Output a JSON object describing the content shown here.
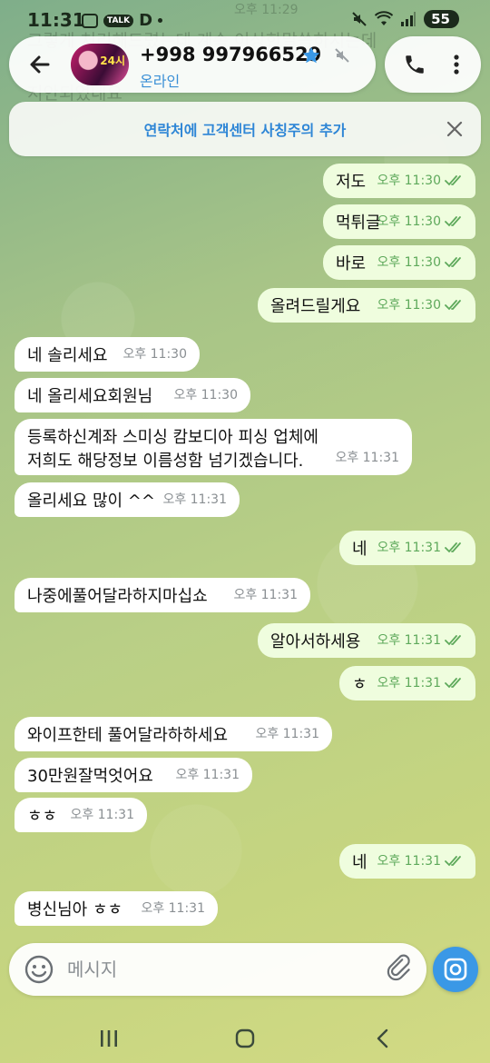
{
  "status_bar": {
    "time": "11:31",
    "talk_badge": "TALK",
    "d_badge": "D",
    "battery": "55"
  },
  "ghost_lines": [
    "그렇게 처리해드렸는데 계속 이상한말씀하시는데",
    "지안되었네요"
  ],
  "ghost_time": "오후 11:29",
  "header": {
    "contact_name": "+998 997966529",
    "status": "온라인",
    "avatar_label": "24시"
  },
  "banner": {
    "text": "연락처에 고객센터 사칭주의 추가"
  },
  "messages": [
    {
      "dir": "out",
      "text": "저도",
      "time": "오후 11:30"
    },
    {
      "dir": "out",
      "text": "먹튀글",
      "time": "오후 11:30"
    },
    {
      "dir": "out",
      "text": "바로",
      "time": "오후 11:30"
    },
    {
      "dir": "out",
      "text": "올려드릴게요",
      "time": "오후 11:30"
    },
    {
      "dir": "in",
      "text": "네 솔리세요",
      "time": "오후 11:30"
    },
    {
      "dir": "in",
      "text": "네 올리세요회원님",
      "time": "오후 11:30"
    },
    {
      "dir": "in",
      "text": "등록하신계좌 스미싱 캄보디아 피싱 업체에",
      "text2": "저희도 해당정보 이름성함 넘기겠습니다.",
      "time": "오후 11:31"
    },
    {
      "dir": "in",
      "text": "올리세요 많이 ^^",
      "time": "오후 11:31"
    },
    {
      "dir": "out",
      "text": "네",
      "time": "오후 11:31"
    },
    {
      "dir": "in",
      "text": "나중에풀어달라하지마십쇼",
      "time": "오후 11:31"
    },
    {
      "dir": "out",
      "text": "알아서하세용",
      "time": "오후 11:31"
    },
    {
      "dir": "out",
      "text": "ㅎ",
      "time": "오후 11:31"
    },
    {
      "dir": "in",
      "text": "와이프한테 풀어달라하하세요",
      "time": "오후 11:31"
    },
    {
      "dir": "in",
      "text": "30만원잘먹엇어요",
      "time": "오후 11:31"
    },
    {
      "dir": "in",
      "text": "ㅎㅎ",
      "time": "오후 11:31"
    },
    {
      "dir": "out",
      "text": "네",
      "time": "오후 11:31"
    },
    {
      "dir": "in",
      "text": "병신님아 ㅎㅎ",
      "time": "오후 11:31"
    }
  ],
  "input": {
    "placeholder": "메시지",
    "value": ""
  },
  "colors": {
    "outgoing_bubble": "#effdde",
    "incoming_bubble": "#ffffff",
    "accent_blue": "#3a98e6",
    "read_check_green": "#5ea95b"
  },
  "icons": {
    "back": "arrow-left-icon",
    "star": "star-icon",
    "mute": "mute-icon",
    "call": "phone-icon",
    "more": "more-vertical-icon",
    "close": "close-icon",
    "emoji": "emoji-icon",
    "attach": "paperclip-icon",
    "camera": "camera-icon"
  }
}
